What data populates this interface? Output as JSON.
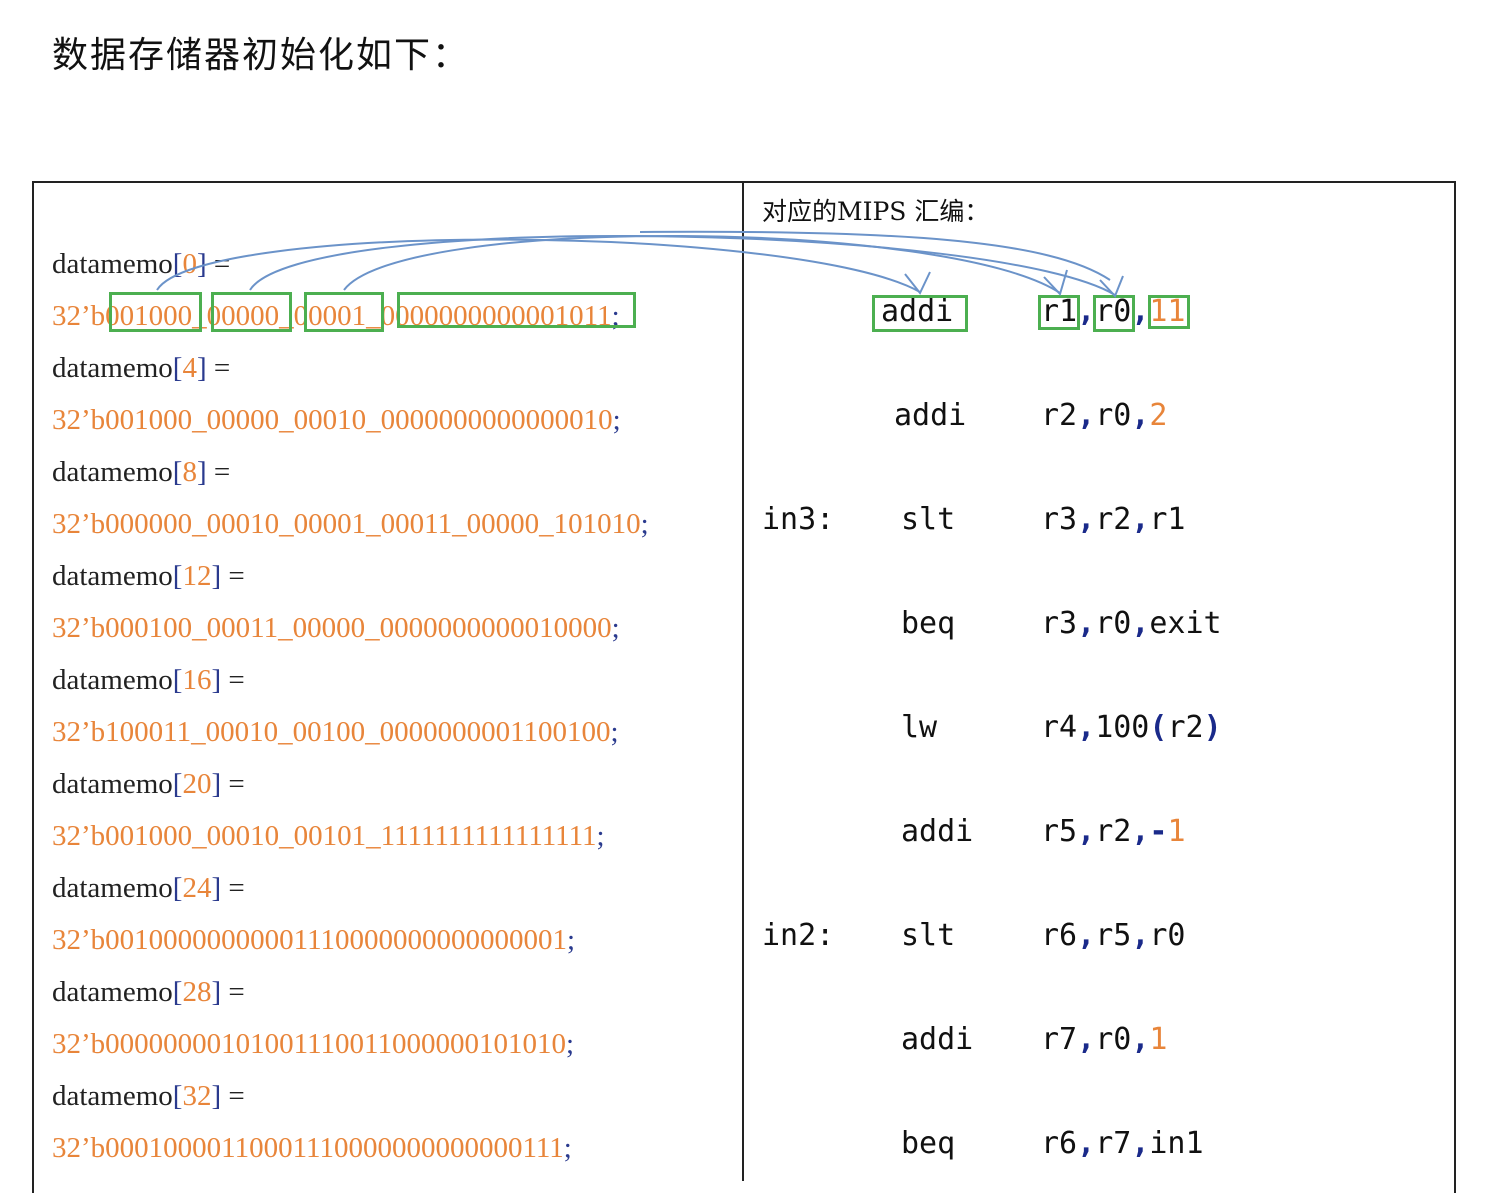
{
  "title": "数据存储器初始化如下：",
  "right_header": "对应的MIPS 汇编：",
  "memory": [
    {
      "addr_prefix": "datamemo",
      "addr": "0",
      "value_prefix": "32’b",
      "value": "001000_00000_00001_0000000000001011"
    },
    {
      "addr_prefix": "datamemo",
      "addr": "4",
      "value_prefix": "32’b",
      "value": "001000_00000_00010_0000000000000010"
    },
    {
      "addr_prefix": "datamemo",
      "addr": "8",
      "value_prefix": "32’b",
      "value": "000000_00010_00001_00011_00000_101010"
    },
    {
      "addr_prefix": "datamemo",
      "addr": "12",
      "value_prefix": "32’b",
      "value": "000100_00011_00000_0000000000010000"
    },
    {
      "addr_prefix": "datamemo",
      "addr": "16",
      "value_prefix": "32’b",
      "value": "100011_00010_00100_0000000001100100"
    },
    {
      "addr_prefix": "datamemo",
      "addr": "20",
      "value_prefix": "32’b",
      "value": "001000_00010_00101_1111111111111111"
    },
    {
      "addr_prefix": "datamemo",
      "addr": "24",
      "value_prefix": "32’b",
      "value": "00100000000001110000000000000001"
    },
    {
      "addr_prefix": "datamemo",
      "addr": "28",
      "value_prefix": "32’b",
      "value": "00000000101001110011000000101010"
    },
    {
      "addr_prefix": "datamemo",
      "addr": "32",
      "value_prefix": "32’b",
      "value": "00010000110001110000000000000111"
    }
  ],
  "asm": [
    {
      "label": "",
      "op": "addi",
      "a": "r1",
      "b": "r0",
      "c": "11",
      "c_num": true
    },
    {
      "label": "",
      "op": "addi",
      "a": "r2",
      "b": "r0",
      "c": "2",
      "c_num": true
    },
    {
      "label": "in3:",
      "op": "slt",
      "a": "r3",
      "b": "r2",
      "c": "r1",
      "c_num": false
    },
    {
      "label": "",
      "op": "beq",
      "a": "r3",
      "b": "r0",
      "c": "exit",
      "c_num": false
    },
    {
      "label": "",
      "op": "lw",
      "a": "r4",
      "b": "100",
      "c": "r2",
      "c_num": false
    },
    {
      "label": "",
      "op": "addi",
      "a": "r5",
      "b": "r2",
      "c": "1",
      "c_num": true
    },
    {
      "label": "in2:",
      "op": "slt",
      "a": "r6",
      "b": "r5",
      "c": "r0",
      "c_num": false
    },
    {
      "label": "",
      "op": "addi",
      "a": "r7",
      "b": "r0",
      "c": "1",
      "c_num": true
    },
    {
      "label": "",
      "op": "beq",
      "a": "r6",
      "b": "r7",
      "c": "in1",
      "c_num": false
    }
  ],
  "colors": {
    "highlight_box": "#4caf50",
    "arrow": "#6b93c9",
    "number": "#e8853a",
    "bracket": "#2a3a8e"
  }
}
